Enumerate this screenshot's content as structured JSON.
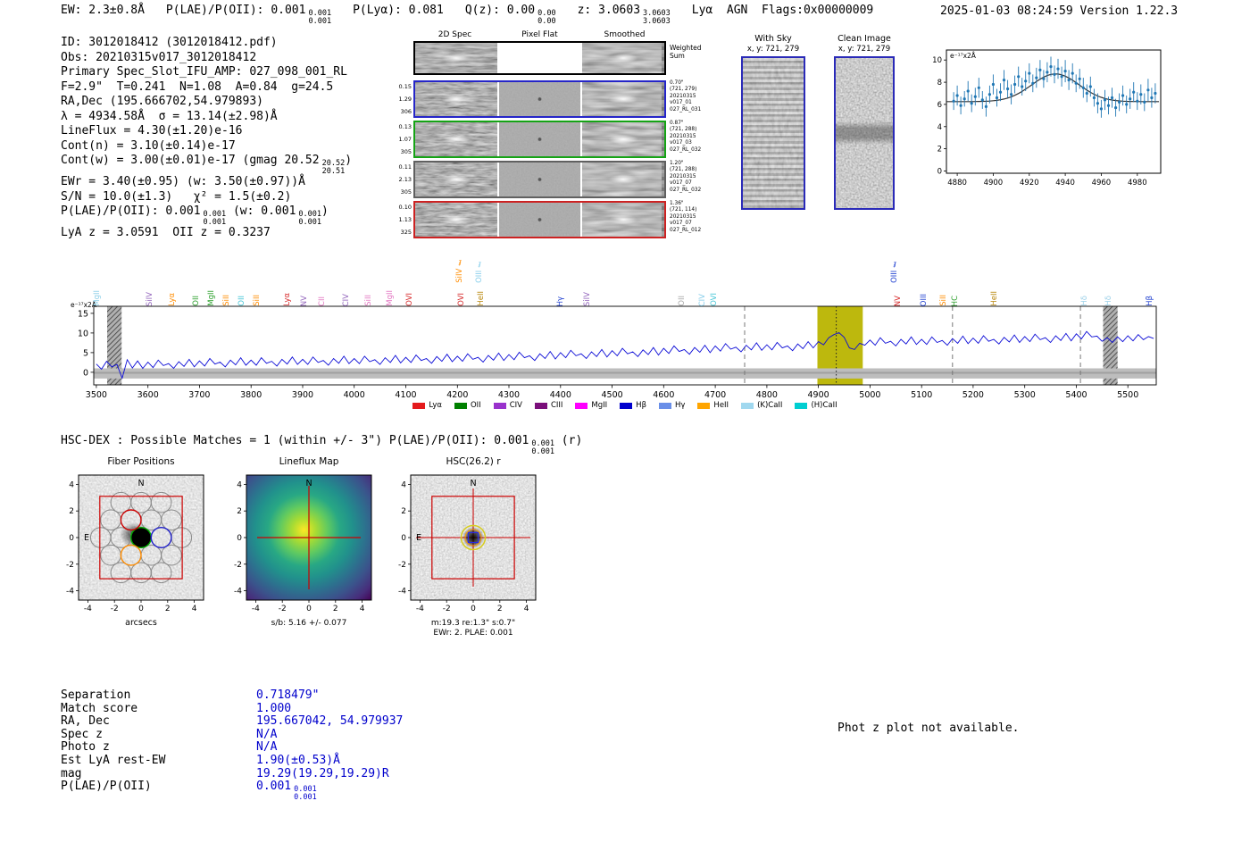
{
  "header": {
    "segments": [
      {
        "t": "EW: 2.3±0.8Å"
      },
      {
        "t": "P(LAE)/P(OII): 0.001",
        "frac": [
          "0.001",
          "0.001"
        ]
      },
      {
        "t": "P(Lyα): 0.081"
      },
      {
        "t": "Q(z): 0.00",
        "frac": [
          "0.00",
          "0.00"
        ]
      },
      {
        "t": "z: 3.0603",
        "frac": [
          "3.0603",
          "3.0603"
        ]
      },
      {
        "t": "Lyα  AGN  Flags:0x00000009"
      }
    ],
    "datetime": "2025-01-03 08:24:59  Version 1.22.3"
  },
  "info_lines": [
    [
      {
        "t": "ID: 3012018412 (3012018412.pdf)"
      }
    ],
    [
      {
        "t": "Obs: 20210315v017_3012018412"
      }
    ],
    [
      {
        "t": "Primary Spec_Slot_IFU_AMP: 027_098_001_RL"
      }
    ],
    [
      {
        "t": "F=2.9\"  T=0.241  N=1.08  A=0.84  g=24.5"
      }
    ],
    [
      {
        "t": "RA,Dec (195.666702,54.979893)"
      }
    ],
    [
      {
        "t": "λ = 4934.58Å  σ = 13.14(±2.98)Å"
      }
    ],
    [
      {
        "t": "LineFlux = 4.30(±1.20)e-16"
      }
    ],
    [
      {
        "t": "Cont(n) = 3.10(±0.14)e-17"
      }
    ],
    [
      {
        "t": "Cont(w) = 3.00(±0.01)e-17 (gmag 20.52",
        "frac": [
          "20.52",
          "20.51"
        ]
      },
      {
        "t": ")"
      }
    ],
    [
      {
        "t": "EWr = 3.40(±0.95) (w: 3.50(±0.97))Å"
      }
    ],
    [
      {
        "t": "S/N = 10.0(±1.3)   χ² = 1.5(±0.2)"
      }
    ],
    [
      {
        "t": "P(LAE)/P(OII): 0.001",
        "frac": [
          "0.001",
          "0.001"
        ]
      },
      {
        "t": " (w: 0.001",
        "frac": [
          "0.001",
          "0.001"
        ]
      },
      {
        "t": ")"
      }
    ],
    [
      {
        "t": "LyA z = 3.0591  OII z = 0.3237"
      }
    ]
  ],
  "spec2d": {
    "col_headers": [
      "2D Spec",
      "Pixel Flat",
      "Smoothed"
    ],
    "weighted_label": [
      "Weighted",
      "Sum"
    ],
    "rows": [
      {
        "left": [
          "0.15",
          "1.29",
          "306"
        ],
        "right": [
          "0.70\"",
          "(721, 279)",
          "20210315",
          "v017_01",
          "027_RL_031"
        ],
        "border": "#2525c8"
      },
      {
        "left": [
          "0.13",
          "1.07",
          "305"
        ],
        "right": [
          "0.87\"",
          "(721, 288)",
          "20210315",
          "v017_03",
          "027_RL_032"
        ],
        "border": "#15a315"
      },
      {
        "left": [
          "0.11",
          "2.13",
          "305"
        ],
        "right": [
          "1.20\"",
          "(721, 288)",
          "20210315",
          "v017_07",
          "027_RL_032"
        ],
        "border": "#606060"
      },
      {
        "left": [
          "0.10",
          "1.13",
          "325"
        ],
        "right": [
          "1.36\"",
          "(721, 114)",
          "20210315",
          "v017_07",
          "027_RL_012"
        ],
        "border": "#cc2222"
      }
    ]
  },
  "withsky": {
    "title": "With Sky",
    "coords": "x, y: 721, 279"
  },
  "clean": {
    "title": "Clean Image",
    "coords": "x, y: 721, 279"
  },
  "chart_data": [
    {
      "type": "scatter",
      "name": "emission-line-zoom",
      "corner_label": "e⁻¹⁷x2Å",
      "xlim": [
        4874,
        4993
      ],
      "ylim": [
        -0.2,
        10.9
      ],
      "x_ticks": [
        4880,
        4900,
        4920,
        4940,
        4960,
        4980
      ],
      "y_ticks": [
        0,
        2,
        4,
        6,
        8,
        10
      ],
      "point_color": "#2077b4",
      "fit": {
        "center": 4934.58,
        "sigma": 13.14,
        "amplitude": 2.5,
        "continuum": 6.25,
        "color": "#333333"
      },
      "points": [
        [
          4878,
          6.3,
          0.8
        ],
        [
          4880,
          6.8,
          0.9
        ],
        [
          4882,
          5.9,
          0.8
        ],
        [
          4884,
          6.5,
          0.7
        ],
        [
          4886,
          7.2,
          0.9
        ],
        [
          4888,
          6.1,
          0.8
        ],
        [
          4890,
          6.7,
          0.8
        ],
        [
          4892,
          7.5,
          0.9
        ],
        [
          4894,
          6.4,
          0.8
        ],
        [
          4896,
          5.8,
          0.9
        ],
        [
          4898,
          6.9,
          0.8
        ],
        [
          4900,
          7.8,
          0.9
        ],
        [
          4902,
          6.6,
          0.8
        ],
        [
          4904,
          7.1,
          0.8
        ],
        [
          4906,
          8.2,
          0.9
        ],
        [
          4908,
          7.4,
          0.8
        ],
        [
          4910,
          6.9,
          0.9
        ],
        [
          4912,
          7.8,
          0.8
        ],
        [
          4914,
          8.5,
          0.9
        ],
        [
          4916,
          7.6,
          0.8
        ],
        [
          4918,
          8.1,
          0.9
        ],
        [
          4920,
          8.8,
          0.9
        ],
        [
          4922,
          7.9,
          0.8
        ],
        [
          4924,
          8.4,
          0.9
        ],
        [
          4926,
          9.1,
          0.9
        ],
        [
          4928,
          8.3,
          0.8
        ],
        [
          4930,
          8.9,
          0.9
        ],
        [
          4932,
          9.4,
          0.9
        ],
        [
          4934,
          8.7,
          0.8
        ],
        [
          4936,
          9.2,
          0.9
        ],
        [
          4938,
          8.5,
          0.9
        ],
        [
          4940,
          9.0,
          1.0
        ],
        [
          4942,
          8.2,
          0.9
        ],
        [
          4944,
          8.8,
          0.9
        ],
        [
          4946,
          7.9,
          0.8
        ],
        [
          4948,
          8.3,
          0.9
        ],
        [
          4950,
          7.5,
          0.9
        ],
        [
          4952,
          7.0,
          0.8
        ],
        [
          4954,
          7.6,
          0.9
        ],
        [
          4956,
          6.6,
          0.8
        ],
        [
          4958,
          6.1,
          0.9
        ],
        [
          4960,
          5.6,
          0.8
        ],
        [
          4962,
          6.4,
          0.9
        ],
        [
          4964,
          5.9,
          0.8
        ],
        [
          4966,
          6.6,
          0.9
        ],
        [
          4968,
          5.7,
          0.8
        ],
        [
          4970,
          6.2,
          0.8
        ],
        [
          4972,
          6.8,
          0.9
        ],
        [
          4974,
          6.0,
          0.8
        ],
        [
          4976,
          6.5,
          0.9
        ],
        [
          4978,
          7.1,
          0.9
        ],
        [
          4980,
          6.3,
          0.8
        ],
        [
          4982,
          6.9,
          0.9
        ],
        [
          4984,
          6.2,
          0.8
        ],
        [
          4986,
          7.3,
          1.0
        ],
        [
          4988,
          6.6,
          0.9
        ],
        [
          4990,
          7.0,
          0.9
        ]
      ]
    },
    {
      "type": "line",
      "name": "full-spectrum",
      "corner_label": "e⁻¹⁷x2Å",
      "xlim": [
        3495,
        5555
      ],
      "ylim": [
        -3.2,
        16.8
      ],
      "x_ticks": [
        3500,
        3600,
        3700,
        3800,
        3900,
        4000,
        4100,
        4200,
        4300,
        4400,
        4500,
        4600,
        4700,
        4800,
        4900,
        5000,
        5100,
        5200,
        5300,
        5400,
        5500
      ],
      "y_ticks": [
        0,
        5,
        10,
        15
      ],
      "line_color": "#0b0bd6",
      "x_start": 3500,
      "x_step": 10,
      "values": [
        2.1,
        0.8,
        2.8,
        1.4,
        2.0,
        -1.5,
        3.2,
        1.1,
        2.9,
        1.0,
        2.6,
        1.2,
        3.1,
        1.7,
        2.2,
        1.0,
        2.7,
        1.5,
        3.3,
        1.4,
        2.9,
        1.6,
        3.5,
        2.1,
        2.6,
        1.4,
        3.1,
        1.9,
        3.7,
        1.8,
        3.1,
        1.8,
        3.7,
        2.3,
        2.8,
        1.6,
        3.3,
        2.1,
        3.9,
        2.0,
        3.3,
        2.0,
        3.9,
        2.5,
        3.0,
        1.8,
        3.5,
        2.3,
        4.1,
        2.2,
        3.5,
        2.2,
        4.1,
        2.7,
        3.2,
        2.0,
        3.7,
        2.5,
        4.3,
        2.4,
        3.8,
        2.5,
        4.4,
        3.0,
        3.5,
        2.3,
        4.0,
        2.8,
        4.6,
        2.7,
        4.1,
        2.8,
        4.7,
        3.3,
        3.8,
        2.6,
        4.3,
        3.1,
        4.9,
        3.0,
        4.5,
        3.2,
        5.1,
        3.7,
        4.2,
        3.0,
        4.7,
        3.5,
        5.3,
        3.4,
        5.0,
        3.7,
        5.6,
        4.2,
        4.7,
        3.5,
        5.2,
        4.0,
        5.8,
        3.9,
        5.5,
        4.2,
        6.1,
        4.7,
        5.2,
        4.0,
        5.7,
        4.5,
        6.3,
        4.4,
        6.1,
        4.8,
        6.7,
        5.3,
        5.8,
        4.6,
        6.3,
        5.1,
        6.9,
        5.0,
        6.7,
        5.4,
        7.3,
        5.9,
        6.4,
        5.2,
        6.9,
        5.7,
        7.5,
        5.6,
        7.0,
        5.7,
        7.6,
        6.2,
        6.7,
        5.5,
        7.2,
        6.0,
        7.8,
        6.2,
        7.8,
        7.0,
        8.8,
        9.6,
        10.1,
        8.9,
        6.2,
        5.8,
        7.4,
        6.9,
        8.2,
        6.9,
        8.8,
        7.4,
        7.9,
        6.7,
        8.4,
        7.2,
        9.0,
        7.1,
        8.4,
        7.1,
        9.0,
        7.6,
        8.1,
        6.9,
        8.6,
        7.4,
        9.2,
        7.3,
        8.7,
        7.4,
        9.3,
        7.9,
        8.4,
        7.2,
        8.9,
        7.7,
        9.5,
        7.6,
        9.1,
        7.8,
        9.7,
        8.3,
        8.8,
        7.6,
        9.3,
        8.1,
        9.9,
        8.0,
        9.8,
        8.5,
        10.4,
        9.0,
        9.2,
        7.9,
        8.8,
        7.6,
        9.0,
        7.8,
        9.3,
        8.0,
        9.6,
        8.3,
        9.1,
        8.6
      ],
      "highlight_region": {
        "x0": 4898,
        "x1": 4986,
        "color": "#b9b400",
        "center_line": 4934.58
      },
      "hatch_regions": [
        [
          3521,
          3549
        ],
        [
          5452,
          5480
        ]
      ],
      "dashed_lines": [
        4757,
        5160,
        5408
      ],
      "gray_band": {
        "y0": -1.6,
        "y1": 1.0
      },
      "emission_labels": [
        {
          "x": 3505,
          "t": "MgII",
          "c": "#8fd0e8"
        },
        {
          "x": 3608,
          "t": "SiIV",
          "c": "#9467bd"
        },
        {
          "x": 3650,
          "t": "Lyα",
          "c": "#ff8c00"
        },
        {
          "x": 3697,
          "t": "OII",
          "c": "#2ca02c"
        },
        {
          "x": 3727,
          "t": "MgII",
          "c": "#2ca02c"
        },
        {
          "x": 3757,
          "t": "SiII",
          "c": "#ff8c00"
        },
        {
          "x": 3786,
          "t": "OII",
          "c": "#45c5d6"
        },
        {
          "x": 3815,
          "t": "SiII",
          "c": "#ff8c00"
        },
        {
          "x": 3874,
          "t": "Lyα",
          "c": "#d62728"
        },
        {
          "x": 3907,
          "t": "NV",
          "c": "#9467bd"
        },
        {
          "x": 3941,
          "t": "CII",
          "c": "#e377c2"
        },
        {
          "x": 3989,
          "t": "CIV",
          "c": "#9467bd"
        },
        {
          "x": 4031,
          "t": "SiII",
          "c": "#e377c2"
        },
        {
          "x": 4073,
          "t": "MgII",
          "c": "#e377c2"
        },
        {
          "x": 4111,
          "t": "OVI",
          "c": "#d62728"
        },
        {
          "x": 4211,
          "t": "OVI",
          "c": "#d62728"
        },
        {
          "x": 4250,
          "t": "HeII",
          "c": "#b8860b"
        },
        {
          "x": 4404,
          "t": "Hγ",
          "c": "#2040d0"
        },
        {
          "x": 4455,
          "t": "SiIV",
          "c": "#9467bd"
        },
        {
          "x": 4640,
          "t": "OII",
          "c": "#a8a8a8"
        },
        {
          "x": 4679,
          "t": "CIV",
          "c": "#87ceeb"
        },
        {
          "x": 4701,
          "t": "OVI",
          "c": "#45c5d6"
        },
        {
          "x": 5058,
          "t": "NV",
          "c": "#d62728"
        },
        {
          "x": 5108,
          "t": "OIII",
          "c": "#2040d0"
        },
        {
          "x": 5146,
          "t": "SiII",
          "c": "#ff8c00"
        },
        {
          "x": 5169,
          "t": "HC",
          "c": "#2ca02c"
        },
        {
          "x": 5245,
          "t": "HeII",
          "c": "#b8860b"
        },
        {
          "x": 5420,
          "t": "Hδ",
          "c": "#9ad0e8"
        },
        {
          "x": 5466,
          "t": "Hδ",
          "c": "#9ad0e8"
        },
        {
          "x": 5546,
          "t": "Hβ",
          "c": "#2040d0"
        }
      ],
      "elevated_labels": [
        {
          "x": 4208,
          "t": "SiIV ℓ",
          "c": "#ff8c00"
        },
        {
          "x": 4247,
          "t": "OIII ℓ",
          "c": "#87ceeb"
        },
        {
          "x": 5052,
          "t": "OIII ℓ",
          "c": "#2040d0"
        }
      ],
      "legend": [
        {
          "t": "Lyα",
          "c": "#e41a1c"
        },
        {
          "t": "OII",
          "c": "#008000"
        },
        {
          "t": "CIV",
          "c": "#9932cc"
        },
        {
          "t": "CIII",
          "c": "#7b0f7b"
        },
        {
          "t": "MgII",
          "c": "#ff00ff"
        },
        {
          "t": "Hβ",
          "c": "#0000cd"
        },
        {
          "t": "Hγ",
          "c": "#6a8fe8"
        },
        {
          "t": "HeII",
          "c": "#ffa500"
        },
        {
          "t": "(K)CaII",
          "c": "#a0d8ef"
        },
        {
          "t": "(H)CaII",
          "c": "#00ced1"
        }
      ]
    }
  ],
  "hscdex_line": [
    {
      "t": "HSC-DEX : Possible Matches = 1 (within +/- 3\")  P(LAE)/P(OII): 0.001",
      "frac": [
        "0.001",
        "0.001"
      ]
    },
    {
      "t": " (r)"
    }
  ],
  "cutouts": {
    "fiber": {
      "title": "Fiber Positions",
      "xlabel": "arcsecs",
      "ticks": [
        -4,
        -2,
        0,
        2,
        4
      ],
      "north_label": "N",
      "east_label": "E",
      "square_color": "#cc0000",
      "rows": [
        3,
        4,
        5,
        4,
        3
      ],
      "pitch": 1.52,
      "radius": 0.76,
      "highlight_fibers": [
        {
          "dx": 0,
          "dy": 0,
          "color": "#00aa00",
          "filled": true
        },
        {
          "dx": -0.76,
          "dy": 1.32,
          "color": "#cc0000"
        },
        {
          "dx": 1.52,
          "dy": 0,
          "color": "#2222cc"
        },
        {
          "dx": -0.76,
          "dy": -1.32,
          "color": "#ff8c00"
        }
      ]
    },
    "lineflux": {
      "title": "Lineflux Map",
      "caption": "s/b: 5.16 +/- 0.077",
      "ticks": [
        -4,
        -2,
        0,
        2,
        4
      ],
      "north_label": "N",
      "viridis": [
        "#fde725",
        "#aadc32",
        "#5ec962",
        "#28a884",
        "#21918c",
        "#2c728e",
        "#3b528b",
        "#472d7b",
        "#440154"
      ]
    },
    "hsc": {
      "title": "HSC(26.2) r",
      "caption1": "m:19.3 re:1.3\" s:0.7\"",
      "caption2": "EWr: 2. PLAE: 0.001",
      "ticks": [
        -4,
        -2,
        0,
        2,
        4
      ],
      "north_label": "N",
      "east_label": "E"
    }
  },
  "match_table": {
    "rows": [
      {
        "label": "Separation",
        "value": "0.718479\""
      },
      {
        "label": "Match score",
        "value": "1.000"
      },
      {
        "label": "RA, Dec",
        "value": "195.667042, 54.979937"
      },
      {
        "label": "Spec z",
        "value": "N/A"
      },
      {
        "label": "Photo z",
        "value": "N/A"
      },
      {
        "label": "Est LyA rest-EW",
        "value": "1.90(±0.53)Å"
      },
      {
        "label": "mag",
        "value": "19.29(19.29,19.29)R"
      },
      {
        "label": "P(LAE)/P(OII)",
        "value": "0.001",
        "frac": [
          "0.001",
          "0.001"
        ]
      }
    ]
  },
  "photz_note": "Phot z plot not available."
}
